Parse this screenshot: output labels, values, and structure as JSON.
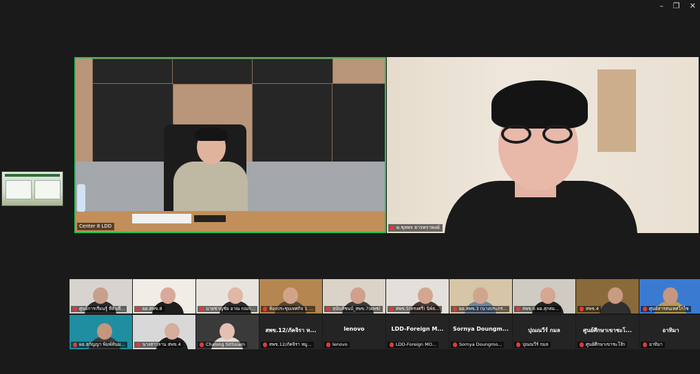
{
  "window": {
    "minimize": "–",
    "restore": "❐",
    "close": "✕"
  },
  "speakers": [
    {
      "name": "Center 8 LDD"
    },
    {
      "name": "ผ.ชุลพร ธารทราพงษ์"
    }
  ],
  "gallery": [
    {
      "name": "ศูนย์การเรียนรู้ ที่ดินที่...",
      "center": ""
    },
    {
      "name": "ผอ.สพข.8",
      "center": ""
    },
    {
      "name": "นายชาญชัย อาณ กณก...",
      "center": ""
    },
    {
      "name": "ห้องประชุมเทศกิจ 1 ...",
      "center": ""
    },
    {
      "name": "สุนันท์ชนบ์_สพข.7(ผพช)",
      "center": ""
    },
    {
      "name": "สพข.5(ทรงศรี) นิพัธ...",
      "center": ""
    },
    {
      "name": "ผอ.สพข.3 (นางประภร...",
      "center": ""
    },
    {
      "name": "สพข.6 ผอ.สุกสม...",
      "center": ""
    },
    {
      "name": "สพข.4",
      "center": ""
    },
    {
      "name": "ศูนย์สารสนเทศโกไซ",
      "center": ""
    },
    {
      "name": "ผอ.สุกัญญา พิมพ์ท้นม...",
      "center": ""
    },
    {
      "name": "นางสาวลาน สพข.4",
      "center": ""
    },
    {
      "name": "Chalong Sittisiam",
      "center": ""
    },
    {
      "name": "สพข.12/ภัคจิรา หมู...",
      "center": "สพข.12/ภัคจิรา ห..."
    },
    {
      "name": "lenovo",
      "center": "lenovo"
    },
    {
      "name": "LDD-Foreign MO...",
      "center": "LDD-Foreign M..."
    },
    {
      "name": "Sornya Doungmo...",
      "center": "Sornya Doungm..."
    },
    {
      "name": "ปุณณวีร์ กมล",
      "center": "ปุณณวีร์ กมล"
    },
    {
      "name": "ศูนย์ศึกษาเขาชะโง๊ก",
      "center": "ศูนย์ศึกษาเขาชะโ..."
    },
    {
      "name": "อาทิมา",
      "center": "อาทิมา"
    }
  ]
}
